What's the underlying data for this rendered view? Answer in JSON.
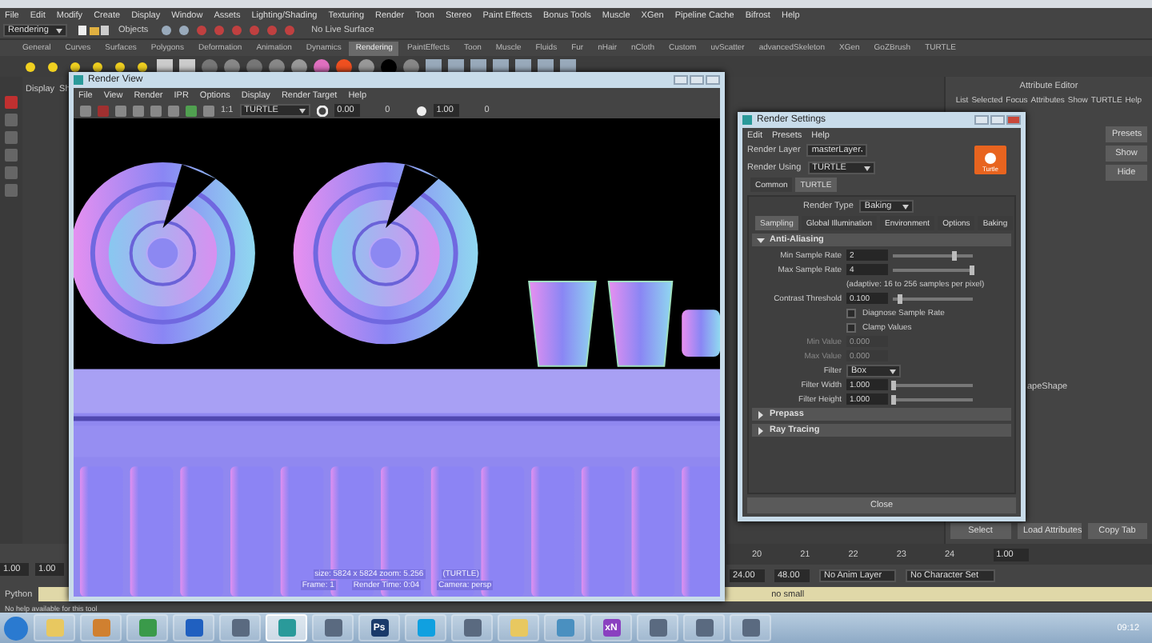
{
  "menu_bar": [
    "File",
    "Edit",
    "Modify",
    "Create",
    "Display",
    "Window",
    "Assets",
    "Lighting/Shading",
    "Texturing",
    "Render",
    "Toon",
    "Stereo",
    "Paint Effects",
    "Bonus Tools",
    "Muscle",
    "XGen",
    "Pipeline Cache",
    "Bifrost",
    "Help"
  ],
  "status_line": {
    "mode": "Rendering",
    "selection": "Objects",
    "live_surface": "No Live Surface"
  },
  "shelf_tabs": [
    {
      "label": "General",
      "selected": false
    },
    {
      "label": "Curves",
      "selected": false
    },
    {
      "label": "Surfaces",
      "selected": false
    },
    {
      "label": "Polygons",
      "selected": false
    },
    {
      "label": "Deformation",
      "selected": false
    },
    {
      "label": "Animation",
      "selected": false
    },
    {
      "label": "Dynamics",
      "selected": false
    },
    {
      "label": "Rendering",
      "selected": true
    },
    {
      "label": "PaintEffects",
      "selected": false
    },
    {
      "label": "Toon",
      "selected": false
    },
    {
      "label": "Muscle",
      "selected": false
    },
    {
      "label": "Fluids",
      "selected": false
    },
    {
      "label": "Fur",
      "selected": false
    },
    {
      "label": "nHair",
      "selected": false
    },
    {
      "label": "nCloth",
      "selected": false
    },
    {
      "label": "Custom",
      "selected": false
    },
    {
      "label": "uvScatter",
      "selected": false
    },
    {
      "label": "advancedSkeleton",
      "selected": false
    },
    {
      "label": "XGen",
      "selected": false
    },
    {
      "label": "GoZBrush",
      "selected": false
    },
    {
      "label": "TURTLE",
      "selected": false
    }
  ],
  "panel": {
    "menu": [
      "Display",
      "Sh"
    ]
  },
  "render_view": {
    "title": "Render View",
    "menu": [
      "File",
      "View",
      "Render",
      "IPR",
      "Options",
      "Display",
      "Render Target",
      "Help"
    ],
    "ratio": "1:1",
    "renderer": "TURTLE",
    "exposure": "0.00",
    "exposure_mark": "0",
    "gamma": "1.00",
    "gamma_mark": "0",
    "info_size": "size: 5824 x 5824 zoom: 5.256",
    "info_renderer": "(TURTLE)",
    "info_frame": "Frame: 1",
    "info_time": "Render Time: 0:04",
    "info_camera": "Camera: persp"
  },
  "render_settings": {
    "title": "Render Settings",
    "menu": [
      "Edit",
      "Presets",
      "Help"
    ],
    "render_layer_label": "Render Layer",
    "render_layer": "masterLayer",
    "render_using_label": "Render Using",
    "render_using": "TURTLE",
    "logo_text": "Turtle",
    "tabs": [
      {
        "label": "Common",
        "selected": false
      },
      {
        "label": "TURTLE",
        "selected": true
      }
    ],
    "render_type_label": "Render Type",
    "render_type": "Baking",
    "subtabs": [
      {
        "label": "Sampling",
        "selected": true
      },
      {
        "label": "Global Illumination",
        "selected": false
      },
      {
        "label": "Environment",
        "selected": false
      },
      {
        "label": "Options",
        "selected": false
      },
      {
        "label": "Baking",
        "selected": false
      }
    ],
    "sections": [
      {
        "title": "Anti-Aliasing",
        "expanded": true
      },
      {
        "title": "Prepass",
        "expanded": false
      },
      {
        "title": "Ray Tracing",
        "expanded": false
      }
    ],
    "rows": [
      {
        "kind": "slider",
        "label": "Min Sample Rate",
        "value": "2",
        "level": 0.75
      },
      {
        "kind": "slider",
        "label": "Max Sample Rate",
        "value": "4",
        "level": 0.97
      },
      {
        "kind": "note",
        "label": "(adaptive: 16 to 256 samples per pixel)"
      },
      {
        "kind": "slider",
        "label": "Contrast Threshold",
        "value": "0.100",
        "level": 0.07
      },
      {
        "kind": "check",
        "label": "Diagnose Sample Rate",
        "checked": false
      },
      {
        "kind": "check",
        "label": "Clamp Values",
        "checked": false
      },
      {
        "kind": "field",
        "label": "Min Value",
        "value": "0.000",
        "disabled": true
      },
      {
        "kind": "field",
        "label": "Max Value",
        "value": "0.000",
        "disabled": true
      },
      {
        "kind": "dropdown",
        "label": "Filter",
        "value": "Box"
      },
      {
        "kind": "slider",
        "label": "Filter Width",
        "value": "1.000",
        "level": 0.0
      },
      {
        "kind": "slider",
        "label": "Filter Height",
        "value": "1.000",
        "level": 0.0
      }
    ],
    "close": "Close"
  },
  "attribute_editor": {
    "title": "Attribute Editor",
    "menu": [
      "List",
      "Selected",
      "Focus",
      "Attributes",
      "Show",
      "TURTLE",
      "Help"
    ],
    "side_buttons": [
      "Presets",
      "Show",
      "Hide"
    ],
    "shape_label": "apeShape",
    "buttons": [
      "Select",
      "Load Attributes",
      "Copy Tab"
    ]
  },
  "time_slider": {
    "ticks": [
      "20",
      "21",
      "22",
      "23",
      "24"
    ],
    "current": "1.00"
  },
  "range": {
    "start": "1.00",
    "start_inner": "1.00",
    "end_inner": "24.00",
    "end": "48.00",
    "anim_layer": "No Anim Layer",
    "character_set": "No Character Set"
  },
  "command_line": {
    "label": "Python",
    "result": "no small"
  },
  "help_line": "No help available for this tool",
  "taskbar": {
    "apps": [
      {
        "kind": "folder",
        "selected": false
      },
      {
        "kind": "tool",
        "selected": false
      },
      {
        "kind": "browser",
        "selected": false
      },
      {
        "kind": "engine",
        "selected": false
      },
      {
        "kind": "app",
        "selected": false
      },
      {
        "kind": "maya",
        "selected": true
      },
      {
        "kind": "app",
        "selected": false
      },
      {
        "kind": "photoshop",
        "label": "Ps",
        "selected": false
      },
      {
        "kind": "chat",
        "selected": false
      },
      {
        "kind": "app",
        "selected": false
      },
      {
        "kind": "folder",
        "selected": false
      },
      {
        "kind": "image",
        "selected": false
      },
      {
        "kind": "viewer",
        "label": "xN",
        "selected": false
      },
      {
        "kind": "app",
        "selected": false
      },
      {
        "kind": "app",
        "selected": false
      },
      {
        "kind": "app",
        "selected": false
      }
    ],
    "clock": "09:12"
  }
}
